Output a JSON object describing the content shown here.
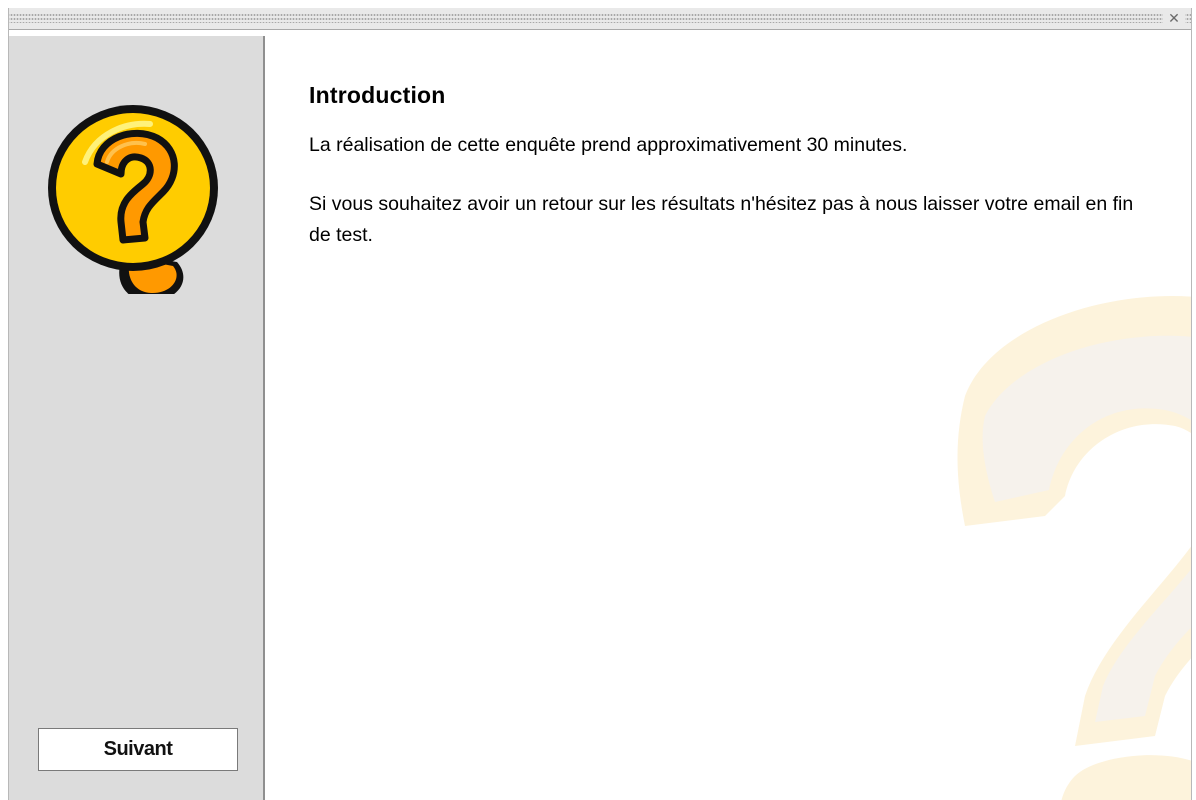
{
  "window": {
    "close_symbol": "✕"
  },
  "sidebar": {
    "logo_icon": "question-mark-icon",
    "next_button_label": "Suivant"
  },
  "main": {
    "heading": "Introduction",
    "paragraph1": "La réalisation de cette enquête prend approximativement 30 minutes.",
    "paragraph2": "Si vous souhaitez avoir un retour sur les résultats n'hésitez pas à nous laisser votre email en fin de test."
  },
  "colors": {
    "sidebar_bg": "#dcdcdc",
    "logo_yellow": "#ffcc00",
    "logo_orange": "#ff9900",
    "watermark_tint": "#fdf6e6"
  }
}
